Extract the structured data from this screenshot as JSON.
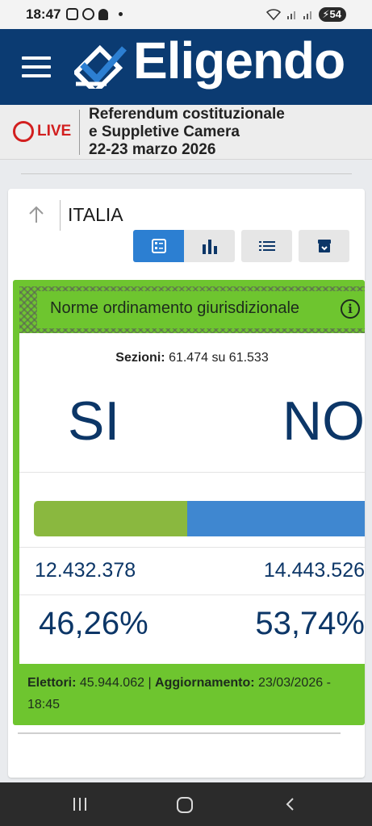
{
  "status_bar": {
    "time": "18:47",
    "battery": "54",
    "icons": [
      "screenshot-icon",
      "facebook-icon",
      "bell-icon",
      "dot-icon",
      "wifi-icon",
      "signal-icon",
      "battery-icon"
    ]
  },
  "header": {
    "brand": "Eligendo",
    "menu_icon": "hamburger-icon",
    "colors": {
      "header_bg": "#0b3b72"
    }
  },
  "live_bar": {
    "live_label": "LIVE",
    "title_line1": "Referendum costituzionale",
    "title_line2": "e Suppletive Camera",
    "title_line3": "22-23 marzo 2026"
  },
  "breadcrumb": {
    "location": "ITALIA"
  },
  "view_toolbar": {
    "buttons": [
      {
        "icon": "card-view-icon",
        "active": true
      },
      {
        "icon": "bar-chart-icon",
        "active": false
      },
      {
        "icon": "list-icon",
        "active": false
      },
      {
        "icon": "archive-icon",
        "active": false
      }
    ]
  },
  "result": {
    "question": "Norme ordinamento giurisdizionale",
    "sezioni_label": "Sezioni:",
    "sezioni_value": "61.474 su 61.533",
    "si_label": "SI",
    "no_label": "NO",
    "si_votes": "12.432.378",
    "no_votes": "14.443.526",
    "si_pct": "46,26%",
    "no_pct": "53,74%",
    "si_share": 0.4626,
    "elettori_label": "Elettori:",
    "elettori_value": "45.944.062",
    "separator": "|",
    "aggiornamento_label": "Aggiornamento:",
    "aggiornamento_value": "23/03/2026 - 18:45",
    "colors": {
      "panel": "#6ec52f",
      "si_bar": "#8ab83f",
      "no_bar": "#3f87d0",
      "numbers": "#0c3667"
    }
  }
}
